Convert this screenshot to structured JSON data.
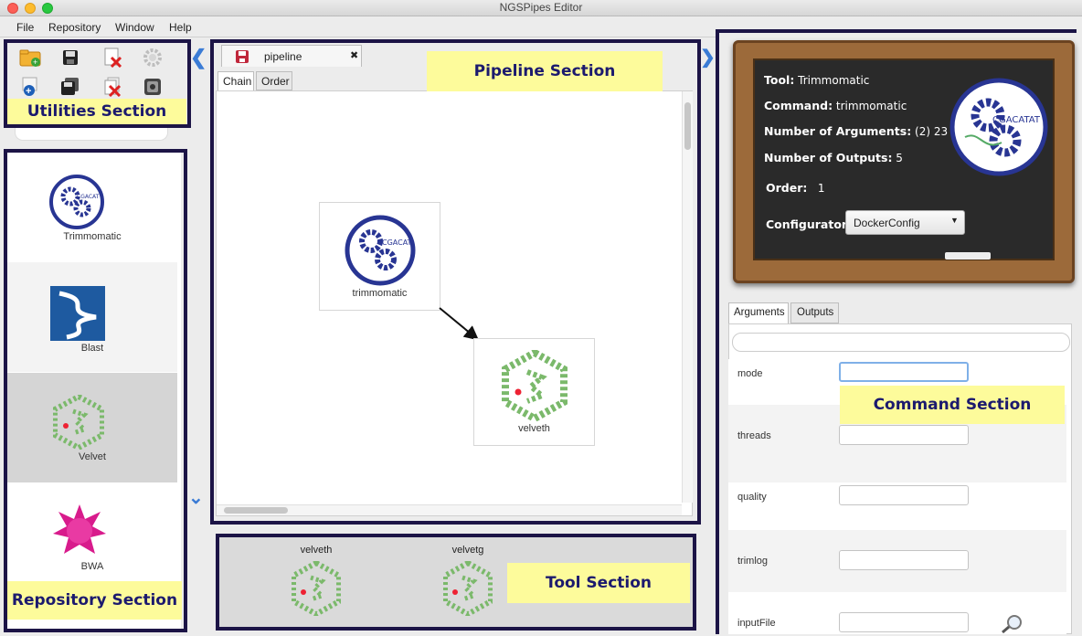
{
  "window": {
    "title": "NGSPipes Editor"
  },
  "menu": [
    "File",
    "Repository",
    "Window",
    "Help"
  ],
  "sections": {
    "utilities": "Utilities Section",
    "pipeline": "Pipeline Section",
    "repository": "Repository Section",
    "tool": "Tool Section",
    "command": "Command Section"
  },
  "utilities": {
    "icons": [
      "new-folder-icon",
      "save-icon",
      "delete-file-icon",
      "settings-icon",
      "add-icon",
      "save-all-icon",
      "delete-all-icon",
      "run-icon"
    ]
  },
  "repository": {
    "items": [
      {
        "label": "Trimmomatic",
        "icon": "trimmomatic-gear-logo-icon"
      },
      {
        "label": "Blast",
        "icon": "blast-helix-icon"
      },
      {
        "label": "Velvet",
        "icon": "velvet-hexagon-icon",
        "selected": true
      },
      {
        "label": "BWA",
        "icon": "bwa-star-icon"
      }
    ]
  },
  "pipeline": {
    "tab_title": "pipeline",
    "tab_close": "✖",
    "subtabs": [
      "Chain",
      "Order"
    ],
    "active_subtab": "Chain",
    "nodes": [
      {
        "label": "trimmomatic",
        "icon": "trimmomatic-gear-logo-icon"
      },
      {
        "label": "velveth",
        "icon": "velvet-hexagon-icon"
      }
    ]
  },
  "tools": {
    "items": [
      {
        "label": "velveth",
        "icon": "velvet-hexagon-icon"
      },
      {
        "label": "velvetg",
        "icon": "velvet-hexagon-icon"
      }
    ]
  },
  "command": {
    "tool_label": "Tool:",
    "tool_value": "Trimmomatic",
    "command_label": "Command:",
    "command_value": "trimmomatic",
    "args_label": "Number of Arguments:",
    "args_value": "(2) 23",
    "outputs_label": "Number of Outputs:",
    "outputs_value": "5",
    "order_label": "Order:",
    "order_value": "1",
    "configurator_label": "Configurator:",
    "configurator_value": "DockerConfig",
    "logo_text": "CGACATAT",
    "tabs": [
      "Arguments",
      "Outputs"
    ],
    "active_tab": "Arguments",
    "arguments": [
      {
        "name": "mode",
        "value": ""
      },
      {
        "name": "threads",
        "value": ""
      },
      {
        "name": "quality",
        "value": ""
      },
      {
        "name": "trimlog",
        "value": ""
      },
      {
        "name": "inputFile",
        "value": ""
      }
    ]
  },
  "colors": {
    "frame": "#1c1446",
    "label_bg": "#fdfb9b",
    "label_text": "#1c1a6e",
    "accent_blue": "#2d4aa0"
  }
}
